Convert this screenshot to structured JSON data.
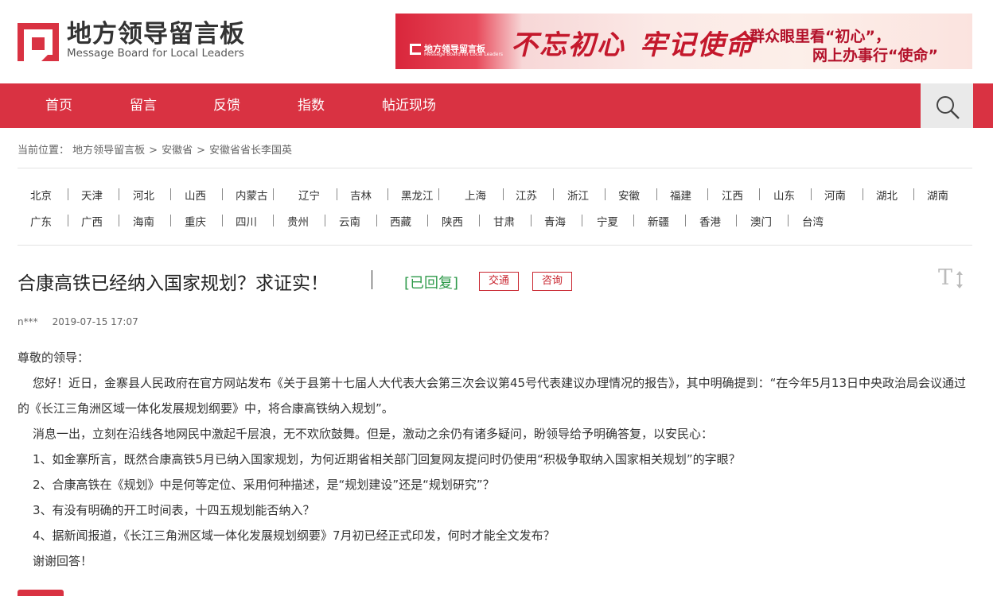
{
  "header": {
    "logo_cn": "地方领导留言板",
    "logo_en": "Message Board for Local Leaders",
    "banner": {
      "logo_cn": "地方领导留言板",
      "logo_en": "Message Board for Local Leaders",
      "slogan_a": "不忘初心",
      "slogan_b": "牢记使命",
      "line1": "群众眼里看“初心”，",
      "line2": "网上办事行“使命”"
    }
  },
  "nav": {
    "items": [
      "首页",
      "留言",
      "反馈",
      "指数",
      "帖近现场"
    ],
    "search_icon": "search-icon"
  },
  "breadcrumb": {
    "prefix": "当前位置：",
    "items": [
      "地方领导留言板",
      "安徽省",
      "安徽省省长李国英"
    ],
    "separator": ">"
  },
  "provinces": {
    "row1": [
      "北京",
      "天津",
      "河北",
      "山西",
      "内蒙古",
      "辽宁",
      "吉林",
      "黑龙江",
      "上海",
      "江苏",
      "浙江",
      "安徽",
      "福建",
      "江西",
      "山东",
      "河南",
      "湖北",
      "湖南"
    ],
    "row2": [
      "广东",
      "广西",
      "海南",
      "重庆",
      "四川",
      "贵州",
      "云南",
      "西藏",
      "陕西",
      "甘肃",
      "青海",
      "宁夏",
      "新疆",
      "香港",
      "澳门",
      "台湾"
    ]
  },
  "post": {
    "title": "合康高铁已经纳入国家规划？求证实！",
    "status": "[已回复]",
    "tags": [
      "交通",
      "咨询"
    ],
    "font_toggle_icon": "font-size-icon",
    "author": "n***",
    "date": "2019-07-15 17:07",
    "body": [
      "尊敬的领导：",
      "您好！近日，金寨县人民政府在官方网站发布《关于县第十七届人大代表大会第三次会议第45号代表建议办理情况的报告》，其中明确提到：“在今年5月13日中央政治局会议通过的《长江三角洲区域一体化发展规划纲要》中，将合康高铁纳入规划”。",
      "消息一出，立刻在沿线各地网民中激起千层浪，无不欢欣鼓舞。但是，激动之余仍有诸多疑问，盼领导给予明确答复，以安民心：",
      "1、如金寨所言，既然合康高铁5月已纳入国家规划，为何近期省相关部门回复网友提问时仍使用“积极争取纳入国家相关规划”的字眼？",
      "2、合康高铁在《规划》中是何等定位、采用何种描述，是“规划建设”还是“规划研究”？",
      "3、有没有明确的开工时间表，十四五规划能否纳入？",
      "4、据新闻报道，《长江三角洲区域一体化发展规划纲要》7月初已经正式印发，何时才能全文发布？",
      "谢谢回答！"
    ]
  },
  "colors": {
    "brand_red": "#d93242",
    "status_green": "#2e9a4a",
    "tag_red": "#c9252f"
  }
}
